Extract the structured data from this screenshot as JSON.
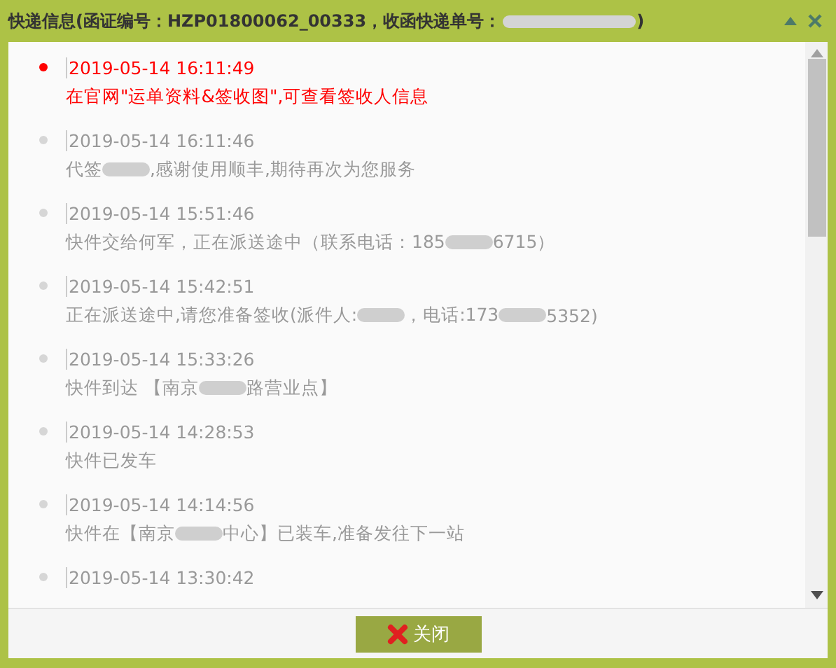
{
  "window": {
    "title_parts": [
      "快递信息(函证编号：HZP01800062_00333，收函快递单号：",
      ")"
    ]
  },
  "events": [
    {
      "time": "2019-05-14 16:11:49",
      "parts": [
        "在官网\"运单资料&签收图\",可查看签收人信息"
      ],
      "latest": true
    },
    {
      "time": "2019-05-14 16:11:46",
      "parts": [
        "代签",
        ",感谢使用顺丰,期待再次为您服务"
      ],
      "latest": false
    },
    {
      "time": "2019-05-14 15:51:46",
      "parts": [
        "快件交给何军，正在派送途中（联系电话：185",
        "6715）"
      ],
      "latest": false
    },
    {
      "time": "2019-05-14 15:42:51",
      "parts": [
        "正在派送途中,请您准备签收(派件人:",
        "，电话:173",
        "5352)"
      ],
      "latest": false
    },
    {
      "time": "2019-05-14 15:33:26",
      "parts": [
        "快件到达 【南京",
        "路营业点】"
      ],
      "latest": false
    },
    {
      "time": "2019-05-14 14:28:53",
      "parts": [
        "快件已发车"
      ],
      "latest": false
    },
    {
      "time": "2019-05-14 14:14:56",
      "parts": [
        "快件在【南京",
        "中心】已装车,准备发往下一站"
      ],
      "latest": false
    },
    {
      "time": "2019-05-14 13:30:42",
      "latest": false
    }
  ],
  "close_button": {
    "label": "关闭"
  }
}
